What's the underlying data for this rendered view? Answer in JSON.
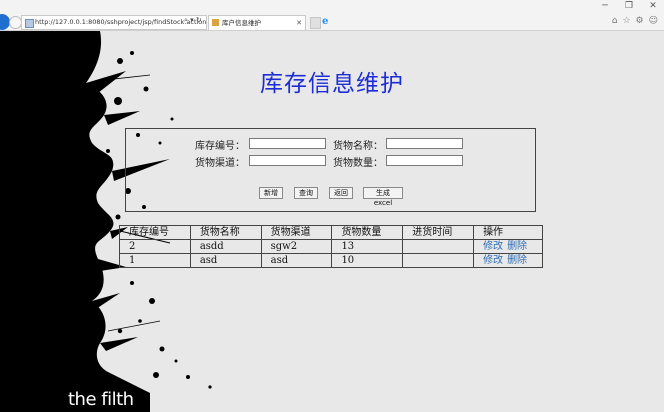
{
  "browser": {
    "url": "http://127.0.0.1:8080/sshproject/jsp/findStock.action",
    "tab_title": "库户信息维护",
    "address_tools": "⌕ ▾ ↻"
  },
  "page": {
    "title": "库存信息维护",
    "banner_text": "the filth"
  },
  "form": {
    "stock_no_label": "库存编号：",
    "goods_name_label": "货物名称：",
    "goods_channel_label": "货物渠道：",
    "goods_qty_label": "货物数量：",
    "stock_no_value": "",
    "goods_name_value": "",
    "goods_channel_value": "",
    "goods_qty_value": ""
  },
  "buttons": {
    "add": "新增",
    "query": "查询",
    "back": "返回",
    "excel": "生成excel"
  },
  "table": {
    "headers": [
      "库存编号",
      "货物名称",
      "货物渠道",
      "货物数量",
      "进货时间",
      "操作"
    ],
    "rows": [
      {
        "id": "2",
        "name": "asdd",
        "channel": "sgw2",
        "qty": "13",
        "time": "",
        "edit": "修改",
        "delete": "删除"
      },
      {
        "id": "1",
        "name": "asd",
        "channel": "asd",
        "qty": "10",
        "time": "",
        "edit": "修改",
        "delete": "删除"
      }
    ]
  },
  "colors": {
    "title": "#1d2dd6",
    "link": "#2f6fb5",
    "ink": "#000000",
    "page_bg": "#e8e8e8"
  }
}
